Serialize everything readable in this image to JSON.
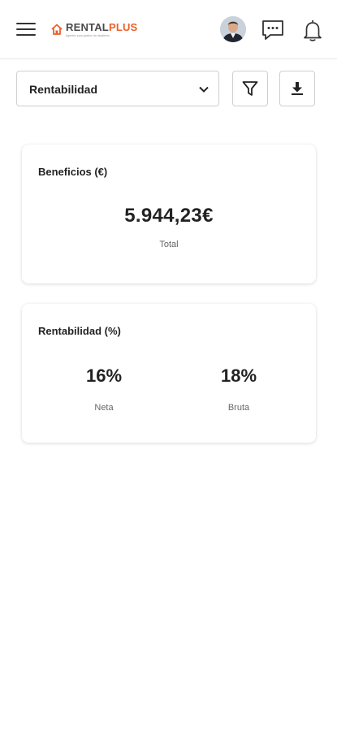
{
  "header": {
    "logo": {
      "brand_part1": "RENTAL",
      "brand_part2": "PLUS",
      "tagline": "Agentes para gestión de alquileres",
      "brand_color": "#e8622c"
    },
    "icons": [
      "menu-icon",
      "chat-icon",
      "bell-icon"
    ]
  },
  "toolbar": {
    "select_value": "Rentabilidad",
    "filter_icon": "filter-icon",
    "download_icon": "download-icon"
  },
  "beneficios": {
    "title": "Beneficios (€)",
    "value": "5.944,23€",
    "label": "Total"
  },
  "rentabilidad": {
    "title": "Rentabilidad (%)",
    "neta": {
      "value": "16%",
      "label": "Neta"
    },
    "bruta": {
      "value": "18%",
      "label": "Bruta"
    }
  }
}
